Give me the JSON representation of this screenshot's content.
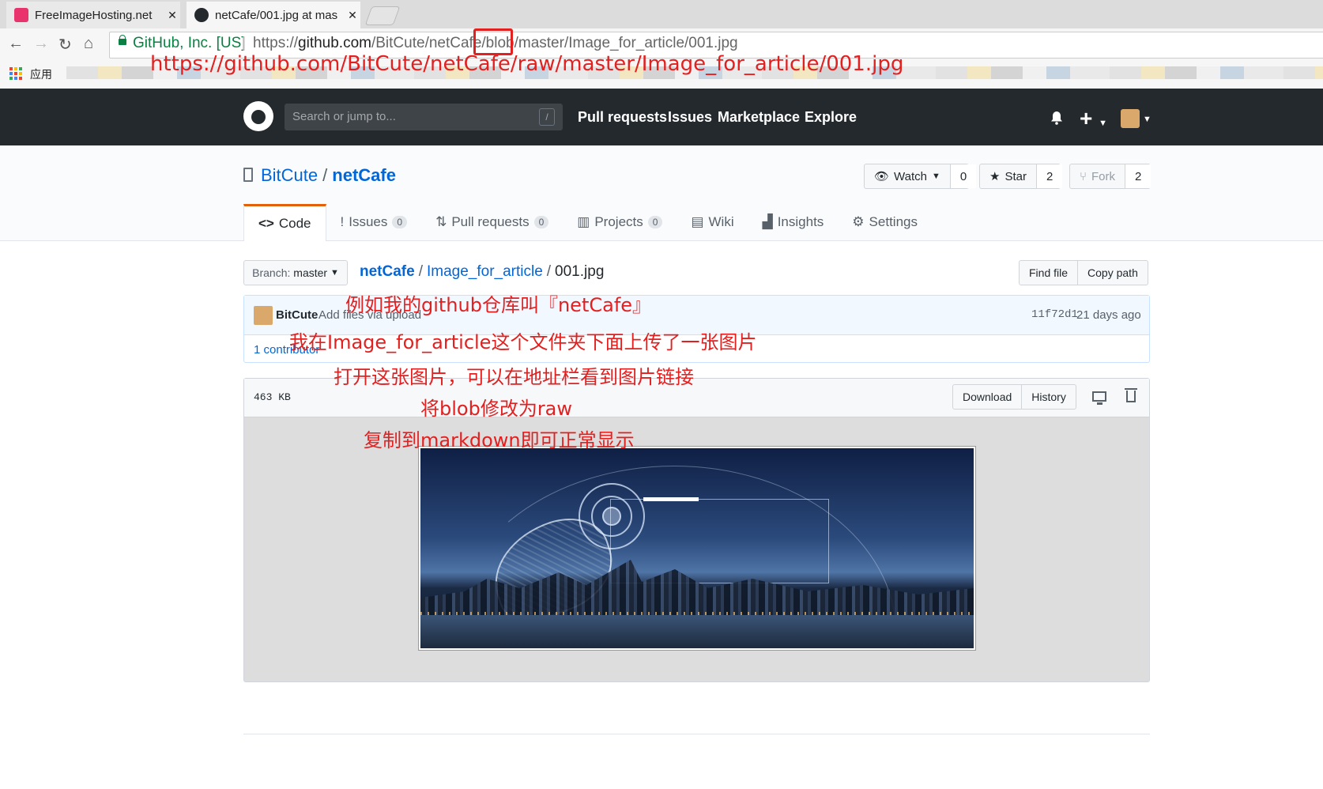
{
  "browser": {
    "tabs": [
      {
        "title": "FreeImageHosting.net",
        "active": false,
        "favicon_color": "#e8336d"
      },
      {
        "title": "netCafe/001.jpg at mas",
        "active": true,
        "favicon_color": "#24292e"
      }
    ],
    "secure_label": "GitHub, Inc. [US]",
    "url": {
      "scheme": "https://",
      "domain": "github.com",
      "path": "/BitCute/netCafe/blob/master/Image_for_article/001.jpg"
    },
    "bookmarks_label": "应用"
  },
  "github": {
    "search_placeholder": "Search or jump to...",
    "search_shortcut": "/",
    "nav": [
      "Pull requests",
      "Issues",
      "Marketplace",
      "Explore"
    ],
    "plus_label": "+"
  },
  "repo": {
    "owner": "BitCute",
    "separator": "/",
    "name": "netCafe",
    "watch": {
      "label": "Watch",
      "count": "0"
    },
    "star": {
      "label": "Star",
      "count": "2"
    },
    "fork": {
      "label": "Fork",
      "count": "2"
    },
    "tabs": [
      {
        "label": "Code",
        "icon": "<>",
        "count": null
      },
      {
        "label": "Issues",
        "icon": "!",
        "count": "0"
      },
      {
        "label": "Pull requests",
        "icon": "⇅",
        "count": "0"
      },
      {
        "label": "Projects",
        "icon": "▥",
        "count": "0"
      },
      {
        "label": "Wiki",
        "icon": "▤",
        "count": null
      },
      {
        "label": "Insights",
        "icon": "▟",
        "count": null
      },
      {
        "label": "Settings",
        "icon": "⚙",
        "count": null
      }
    ]
  },
  "file": {
    "branch_prefix": "Branch:",
    "branch": "master",
    "breadcrumb": [
      "netCafe",
      "Image_for_article",
      "001.jpg"
    ],
    "find_file": "Find file",
    "copy_path": "Copy path",
    "commit": {
      "author": "BitCute",
      "message": "Add files via upload",
      "sha": "11f72d1",
      "age": "21 days ago"
    },
    "contributors": "1 contributor",
    "size": "463 KB",
    "download": "Download",
    "history": "History"
  },
  "annotations": {
    "raw_url": "https://github.com/BitCute/netCafe/raw/master/Image_for_article/001.jpg",
    "steps": [
      "例如我的github仓库叫『netCafe』",
      "我在Image_for_article这个文件夹下面上传了一张图片",
      "打开这张图片，可以在地址栏看到图片链接",
      "将blob修改为raw",
      "复制到markdown即可正常显示"
    ],
    "color": "#e32020"
  },
  "colors": {
    "gh_header": "#24292e",
    "link": "#0366d6",
    "tab_accent": "#e36209"
  }
}
